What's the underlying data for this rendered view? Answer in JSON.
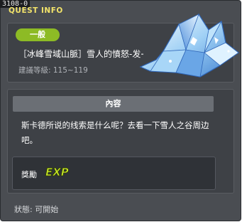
{
  "window": {
    "quest_id": "3108-0",
    "title": "QUEST INFO"
  },
  "quest": {
    "category": "一般",
    "name": "［冰峰雪域山脈］雪人的憤怒-发→",
    "recommended_level": "建議等級: 115~119",
    "art_icon": "ice-crystal-icon"
  },
  "content": {
    "header": "內容",
    "text": "斯卡德所说的线索是什么呢？去看一下雪人之谷周边吧。"
  },
  "reward": {
    "label": "獎勵",
    "exp_label": "EXP",
    "exp_icon": "exp-icon"
  },
  "status": {
    "text": "狀態:  可開始"
  },
  "colors": {
    "title": "#f2e36a",
    "badge": "#8dbb25",
    "window_bg": "#4a4d52",
    "exp": "#c8e628"
  }
}
